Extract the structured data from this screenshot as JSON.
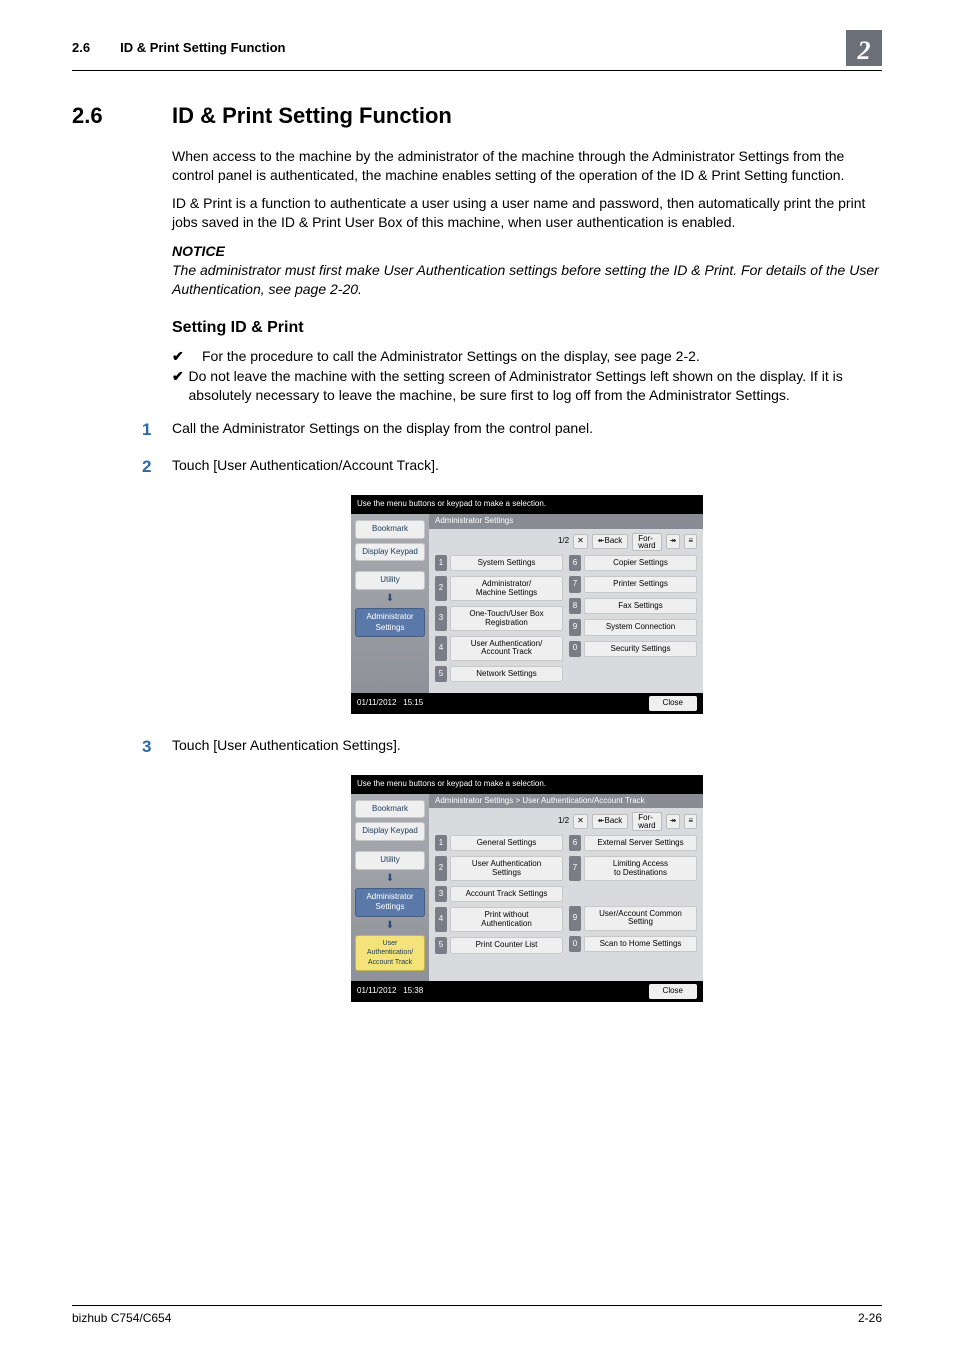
{
  "header": {
    "section_num": "2.6",
    "section_title": "ID & Print Setting Function",
    "chapter_num": "2"
  },
  "heading": {
    "num": "2.6",
    "title": "ID & Print Setting Function"
  },
  "para1": "When access to the machine by the administrator of the machine through the Administrator Settings from the control panel is authenticated, the machine enables setting of the operation of the ID & Print Setting function.",
  "para2": "ID & Print is a function to authenticate a user using a user name and password, then automatically print the print jobs saved in the ID & Print User Box of this machine, when user authentication is enabled.",
  "notice_label": "NOTICE",
  "notice_body": "The administrator must first make User Authentication settings before setting the ID & Print. For details of the User Authentication, see page 2-20.",
  "h2": "Setting ID & Print",
  "checks": [
    "For the procedure to call the Administrator Settings on the display, see page 2-2.",
    "Do not leave the machine with the setting screen of Administrator Settings left shown on the display. If it is absolutely necessary to leave the machine, be sure first to log off from the Administrator Settings."
  ],
  "steps": [
    {
      "n": "1",
      "t": "Call the Administrator Settings on the display from the control panel."
    },
    {
      "n": "2",
      "t": "Touch [User Authentication/Account Track]."
    },
    {
      "n": "3",
      "t": "Touch [User Authentication Settings]."
    }
  ],
  "shot_common": {
    "top_msg": "Use the menu buttons or keypad to make a selection.",
    "side_bookmark": "Bookmark",
    "side_display": "Display Keypad",
    "side_utility": "Utility",
    "side_admin": "Administrator\nSettings",
    "page_ind": "1/2",
    "back": "↞Back",
    "forward": "For-\nward",
    "fwd_arrow": "↠",
    "close": "Close",
    "x": "✕",
    "list": "≡"
  },
  "shot1": {
    "crumb": "Administrator Settings",
    "date": "01/11/2012",
    "time": "15:15",
    "left": [
      {
        "n": "1",
        "l": "System Settings"
      },
      {
        "n": "2",
        "l": "Administrator/\nMachine Settings"
      },
      {
        "n": "3",
        "l": "One-Touch/User Box\nRegistration"
      },
      {
        "n": "4",
        "l": "User Authentication/\nAccount Track"
      },
      {
        "n": "5",
        "l": "Network Settings"
      }
    ],
    "right": [
      {
        "n": "6",
        "l": "Copier Settings"
      },
      {
        "n": "7",
        "l": "Printer Settings"
      },
      {
        "n": "8",
        "l": "Fax Settings"
      },
      {
        "n": "9",
        "l": "System Connection"
      },
      {
        "n": "0",
        "l": "Security Settings"
      }
    ]
  },
  "shot2": {
    "crumb": "Administrator Settings > User Authentication/Account Track",
    "side_extra": "User\nAuthentication/\nAccount Track",
    "date": "01/11/2012",
    "time": "15:38",
    "left": [
      {
        "n": "1",
        "l": "General Settings"
      },
      {
        "n": "2",
        "l": "User Authentication\nSettings"
      },
      {
        "n": "3",
        "l": "Account Track Settings"
      },
      {
        "n": "4",
        "l": "Print without\nAuthentication"
      },
      {
        "n": "5",
        "l": "Print Counter List"
      }
    ],
    "right": [
      {
        "n": "6",
        "l": "External Server Settings"
      },
      {
        "n": "7",
        "l": "Limiting Access\nto Destinations"
      },
      {
        "n": "9",
        "l": "User/Account Common Setting"
      },
      {
        "n": "0",
        "l": "Scan to Home Settings"
      }
    ]
  },
  "footer": {
    "left": "bizhub C754/C654",
    "right": "2-26"
  }
}
